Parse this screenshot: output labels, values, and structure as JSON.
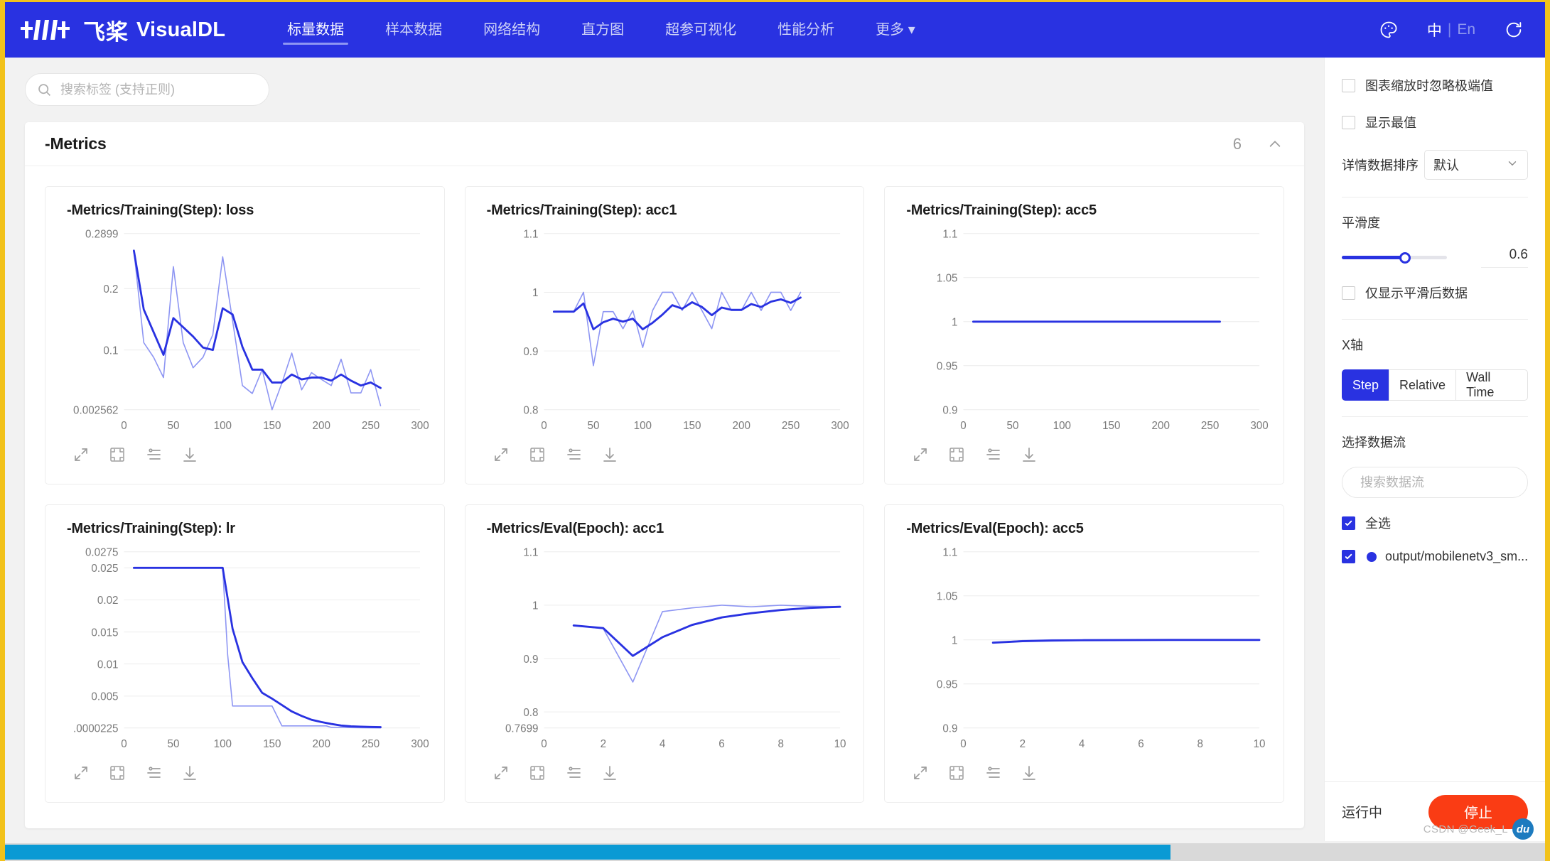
{
  "header": {
    "logo_cn": "飞桨",
    "logo_en": "VisualDL",
    "nav": [
      {
        "label": "标量数据",
        "active": true
      },
      {
        "label": "样本数据",
        "active": false
      },
      {
        "label": "网络结构",
        "active": false
      },
      {
        "label": "直方图",
        "active": false
      },
      {
        "label": "超参可视化",
        "active": false
      },
      {
        "label": "性能分析",
        "active": false
      },
      {
        "label": "更多 ▾",
        "active": false
      }
    ],
    "theme_icon": "palette-icon",
    "lang_cn": "中",
    "lang_sep": "|",
    "lang_en": "En",
    "refresh_icon": "refresh-icon"
  },
  "search": {
    "placeholder": "搜索标签 (支持正则)",
    "value": ""
  },
  "metrics": {
    "title": "-Metrics",
    "count": "6",
    "chevron": "chevron-up-icon"
  },
  "chart_tools": [
    "expand-icon",
    "fit-icon",
    "filter-icon",
    "download-icon"
  ],
  "sidebar": {
    "ignore_outliers": {
      "label": "图表缩放时忽略极端值",
      "checked": false
    },
    "show_extremes": {
      "label": "显示最值",
      "checked": false
    },
    "sort": {
      "label": "详情数据排序",
      "value": "默认"
    },
    "smoothing": {
      "label": "平滑度",
      "value": "0.6",
      "percent": 60
    },
    "only_smoothed": {
      "label": "仅显示平滑后数据",
      "checked": false
    },
    "xaxis": {
      "label": "X轴",
      "options": [
        "Step",
        "Relative",
        "Wall Time"
      ],
      "selected": "Step"
    },
    "streams": {
      "label": "选择数据流",
      "search_placeholder": "搜索数据流",
      "select_all": {
        "label": "全选",
        "checked": true
      },
      "items": [
        {
          "label": "output/mobilenetv3_sm...",
          "checked": true,
          "color": "#2932e1"
        }
      ]
    },
    "footer": {
      "status": "运行中",
      "stop_label": "停止"
    }
  },
  "watermark": {
    "text": "CSDN @Geek_L",
    "badge": "du"
  },
  "colors": {
    "brand": "#2932e1",
    "accent_light": "#8e96f3",
    "stop": "#fa3c14",
    "frame": "#f2c21b"
  },
  "chart_data": [
    {
      "type": "line",
      "title": "-Metrics/Training(Step): loss",
      "xlabel": "",
      "ylabel": "",
      "xticks": [
        0,
        50,
        100,
        150,
        200,
        250,
        300
      ],
      "yticks": [
        "0.2899",
        "0.2",
        "0.1",
        "0.002562"
      ],
      "ytick_values": [
        0.2899,
        0.2,
        0.1,
        0.002562
      ],
      "xlim": [
        0,
        300
      ],
      "ylim": [
        0.002562,
        0.2899
      ],
      "grid": true,
      "series": [
        {
          "name": "raw",
          "color": "#8e96f3",
          "width": 2,
          "x": [
            10,
            20,
            30,
            40,
            50,
            60,
            70,
            80,
            90,
            100,
            110,
            120,
            130,
            140,
            150,
            160,
            170,
            180,
            190,
            200,
            210,
            220,
            230,
            240,
            250,
            260
          ],
          "y": [
            0.262,
            0.112,
            0.088,
            0.055,
            0.236,
            0.112,
            0.071,
            0.088,
            0.125,
            0.252,
            0.148,
            0.042,
            0.029,
            0.068,
            0.0026,
            0.046,
            0.095,
            0.035,
            0.063,
            0.052,
            0.042,
            0.085,
            0.03,
            0.03,
            0.068,
            0.009
          ]
        },
        {
          "name": "smoothed",
          "color": "#2932e1",
          "width": 3.5,
          "x": [
            10,
            20,
            30,
            40,
            50,
            60,
            70,
            80,
            90,
            100,
            110,
            120,
            130,
            140,
            150,
            160,
            170,
            180,
            190,
            200,
            210,
            220,
            230,
            240,
            250,
            260
          ],
          "y": [
            0.262,
            0.166,
            0.129,
            0.092,
            0.152,
            0.137,
            0.122,
            0.104,
            0.1,
            0.168,
            0.158,
            0.105,
            0.068,
            0.068,
            0.047,
            0.047,
            0.06,
            0.052,
            0.055,
            0.055,
            0.05,
            0.06,
            0.05,
            0.042,
            0.047,
            0.038
          ]
        }
      ]
    },
    {
      "type": "line",
      "title": "-Metrics/Training(Step): acc1",
      "xlabel": "",
      "ylabel": "",
      "xticks": [
        0,
        50,
        100,
        150,
        200,
        250,
        300
      ],
      "yticks": [
        "1.1",
        "1",
        "0.9",
        "0.8"
      ],
      "ytick_values": [
        1.1,
        1.0,
        0.9,
        0.8
      ],
      "xlim": [
        0,
        300
      ],
      "ylim": [
        0.8,
        1.1
      ],
      "grid": true,
      "series": [
        {
          "name": "raw",
          "color": "#8e96f3",
          "width": 2,
          "x": [
            10,
            20,
            30,
            40,
            50,
            60,
            70,
            80,
            90,
            100,
            110,
            120,
            130,
            140,
            150,
            160,
            170,
            180,
            190,
            200,
            210,
            220,
            230,
            240,
            250,
            260
          ],
          "y": [
            0.967,
            0.967,
            0.967,
            1.0,
            0.875,
            0.967,
            0.967,
            0.938,
            0.969,
            0.906,
            0.969,
            1.0,
            1.0,
            0.969,
            1.0,
            0.969,
            0.938,
            1.0,
            0.969,
            0.969,
            1.0,
            0.969,
            1.0,
            1.0,
            0.969,
            1.0
          ]
        },
        {
          "name": "smoothed",
          "color": "#2932e1",
          "width": 3.5,
          "x": [
            10,
            20,
            30,
            40,
            50,
            60,
            70,
            80,
            90,
            100,
            110,
            120,
            130,
            140,
            150,
            160,
            170,
            180,
            190,
            200,
            210,
            220,
            230,
            240,
            250,
            260
          ],
          "y": [
            0.967,
            0.967,
            0.967,
            0.981,
            0.937,
            0.949,
            0.955,
            0.95,
            0.955,
            0.937,
            0.948,
            0.962,
            0.978,
            0.972,
            0.983,
            0.975,
            0.961,
            0.974,
            0.97,
            0.97,
            0.98,
            0.975,
            0.984,
            0.988,
            0.982,
            0.991
          ]
        }
      ]
    },
    {
      "type": "line",
      "title": "-Metrics/Training(Step): acc5",
      "xlabel": "",
      "ylabel": "",
      "xticks": [
        0,
        50,
        100,
        150,
        200,
        250,
        300
      ],
      "yticks": [
        "1.1",
        "1.05",
        "1",
        "0.95",
        "0.9"
      ],
      "ytick_values": [
        1.1,
        1.05,
        1.0,
        0.95,
        0.9
      ],
      "xlim": [
        0,
        300
      ],
      "ylim": [
        0.9,
        1.1
      ],
      "grid": true,
      "series": [
        {
          "name": "smoothed",
          "color": "#2932e1",
          "width": 3.5,
          "x": [
            10,
            260
          ],
          "y": [
            1.0,
            1.0
          ]
        }
      ]
    },
    {
      "type": "line",
      "title": "-Metrics/Training(Step): lr",
      "xlabel": "",
      "ylabel": "",
      "xticks": [
        0,
        50,
        100,
        150,
        200,
        250,
        300
      ],
      "yticks": [
        "0.0275",
        "0.025",
        "0.02",
        "0.015",
        "0.01",
        "0.005",
        ".0000225"
      ],
      "ytick_values": [
        0.0275,
        0.025,
        0.02,
        0.015,
        0.01,
        0.005,
        2.25e-05
      ],
      "xlim": [
        0,
        300
      ],
      "ylim": [
        2.25e-05,
        0.0275
      ],
      "grid": true,
      "series": [
        {
          "name": "raw",
          "color": "#8e96f3",
          "width": 2,
          "x": [
            10,
            100,
            105,
            110,
            150,
            155,
            160,
            205,
            210,
            260
          ],
          "y": [
            0.025,
            0.025,
            0.0115,
            0.00345,
            0.00345,
            0.0019,
            0.00035,
            0.00035,
            0.00012,
            2.25e-05
          ]
        },
        {
          "name": "smoothed",
          "color": "#2932e1",
          "width": 3.5,
          "x": [
            10,
            60,
            100,
            110,
            120,
            130,
            140,
            150,
            160,
            170,
            180,
            190,
            200,
            210,
            220,
            230,
            240,
            250,
            260
          ],
          "y": [
            0.025,
            0.025,
            0.025,
            0.0155,
            0.0103,
            0.0078,
            0.0055,
            0.0046,
            0.0036,
            0.0026,
            0.0019,
            0.0013,
            0.00095,
            0.00065,
            0.0004,
            0.00028,
            0.00022,
            0.00018,
            0.00015
          ]
        }
      ]
    },
    {
      "type": "line",
      "title": "-Metrics/Eval(Epoch): acc1",
      "xlabel": "",
      "ylabel": "",
      "xticks": [
        0,
        2,
        4,
        6,
        8,
        10
      ],
      "yticks": [
        "1.1",
        "1",
        "0.9",
        "0.8",
        "0.7699"
      ],
      "ytick_values": [
        1.1,
        1.0,
        0.9,
        0.8,
        0.7699
      ],
      "xlim": [
        0,
        10
      ],
      "ylim": [
        0.7699,
        1.1
      ],
      "grid": true,
      "series": [
        {
          "name": "raw",
          "color": "#8e96f3",
          "width": 2,
          "x": [
            1,
            2,
            3,
            4,
            5,
            6,
            7,
            8,
            9,
            10
          ],
          "y": [
            0.962,
            0.956,
            0.856,
            0.988,
            0.995,
            1.0,
            0.997,
            1.0,
            0.998,
            0.997
          ]
        },
        {
          "name": "smoothed",
          "color": "#2932e1",
          "width": 3.5,
          "x": [
            1,
            2,
            3,
            4,
            5,
            6,
            7,
            8,
            9,
            10
          ],
          "y": [
            0.962,
            0.957,
            0.905,
            0.94,
            0.963,
            0.977,
            0.985,
            0.991,
            0.995,
            0.997
          ]
        }
      ]
    },
    {
      "type": "line",
      "title": "-Metrics/Eval(Epoch): acc5",
      "xlabel": "",
      "ylabel": "",
      "xticks": [
        0,
        2,
        4,
        6,
        8,
        10
      ],
      "yticks": [
        "1.1",
        "1.05",
        "1",
        "0.95",
        "0.9"
      ],
      "ytick_values": [
        1.1,
        1.05,
        1.0,
        0.95,
        0.9
      ],
      "xlim": [
        0,
        10
      ],
      "ylim": [
        0.9,
        1.1
      ],
      "grid": true,
      "series": [
        {
          "name": "raw",
          "color": "#8e96f3",
          "width": 2,
          "x": [
            1,
            2,
            3,
            4,
            5,
            6,
            7,
            8,
            9,
            10
          ],
          "y": [
            0.9968,
            0.9992,
            1.0,
            1.0,
            1.0,
            1.0,
            1.0,
            1.0,
            1.0,
            1.0
          ]
        },
        {
          "name": "smoothed",
          "color": "#2932e1",
          "width": 3.5,
          "x": [
            1,
            2,
            3,
            4,
            5,
            6,
            7,
            8,
            9,
            10
          ],
          "y": [
            0.9968,
            0.9985,
            0.9993,
            0.9996,
            0.9998,
            0.9999,
            1.0,
            1.0,
            1.0,
            1.0
          ]
        }
      ]
    }
  ]
}
